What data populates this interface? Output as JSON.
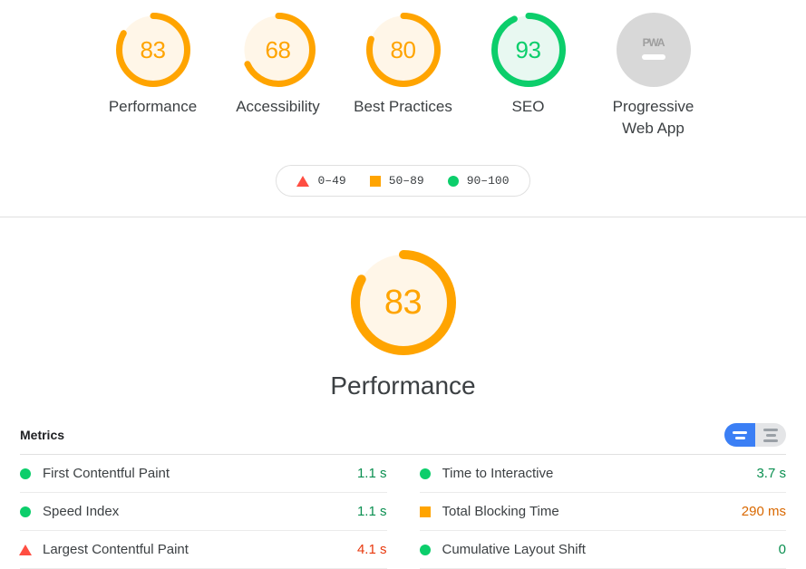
{
  "colors": {
    "pass": "#0cce6b",
    "average": "#ffa400",
    "fail": "#ff4e42",
    "null": "#d8d8d8",
    "pass_text": "#0a8f50",
    "average_text": "#d96800",
    "fail_text": "#e8380d",
    "toggle_active": "#3b7ff5",
    "toggle_inactive": "#e4e5e7"
  },
  "scores": {
    "gauges": [
      {
        "label": "Performance",
        "score": "83",
        "value": 83,
        "rating": "average",
        "type": "gauge"
      },
      {
        "label": "Accessibility",
        "score": "68",
        "value": 68,
        "rating": "average",
        "type": "gauge"
      },
      {
        "label": "Best Practices",
        "score": "80",
        "value": 80,
        "rating": "average",
        "type": "gauge"
      },
      {
        "label": "SEO",
        "score": "93",
        "value": 93,
        "rating": "pass",
        "type": "gauge"
      },
      {
        "label": "Progressive Web App",
        "score": "",
        "value": null,
        "rating": "null",
        "type": "pwa",
        "badge_text": "PWA"
      }
    ]
  },
  "legend": {
    "entries": [
      {
        "shape": "triangle",
        "label": "0–49",
        "rating": "fail"
      },
      {
        "shape": "square",
        "label": "50–89",
        "rating": "average"
      },
      {
        "shape": "circle",
        "label": "90–100",
        "rating": "pass"
      }
    ]
  },
  "category": {
    "title": "Performance",
    "score": "83",
    "value": 83,
    "rating": "average"
  },
  "metrics": {
    "heading": "Metrics",
    "toggle": {
      "active_view": "simple",
      "options": [
        "simple",
        "detailed"
      ]
    },
    "columns": [
      {
        "rows": [
          {
            "name": "First Contentful Paint",
            "value": "1.1 s",
            "rating": "pass",
            "shape": "circle"
          },
          {
            "name": "Speed Index",
            "value": "1.1 s",
            "rating": "pass",
            "shape": "circle"
          },
          {
            "name": "Largest Contentful Paint",
            "value": "4.1 s",
            "rating": "fail",
            "shape": "triangle"
          }
        ]
      },
      {
        "rows": [
          {
            "name": "Time to Interactive",
            "value": "3.7 s",
            "rating": "pass",
            "shape": "circle"
          },
          {
            "name": "Total Blocking Time",
            "value": "290 ms",
            "rating": "average",
            "shape": "square"
          },
          {
            "name": "Cumulative Layout Shift",
            "value": "0",
            "rating": "pass",
            "shape": "circle"
          }
        ]
      }
    ]
  }
}
